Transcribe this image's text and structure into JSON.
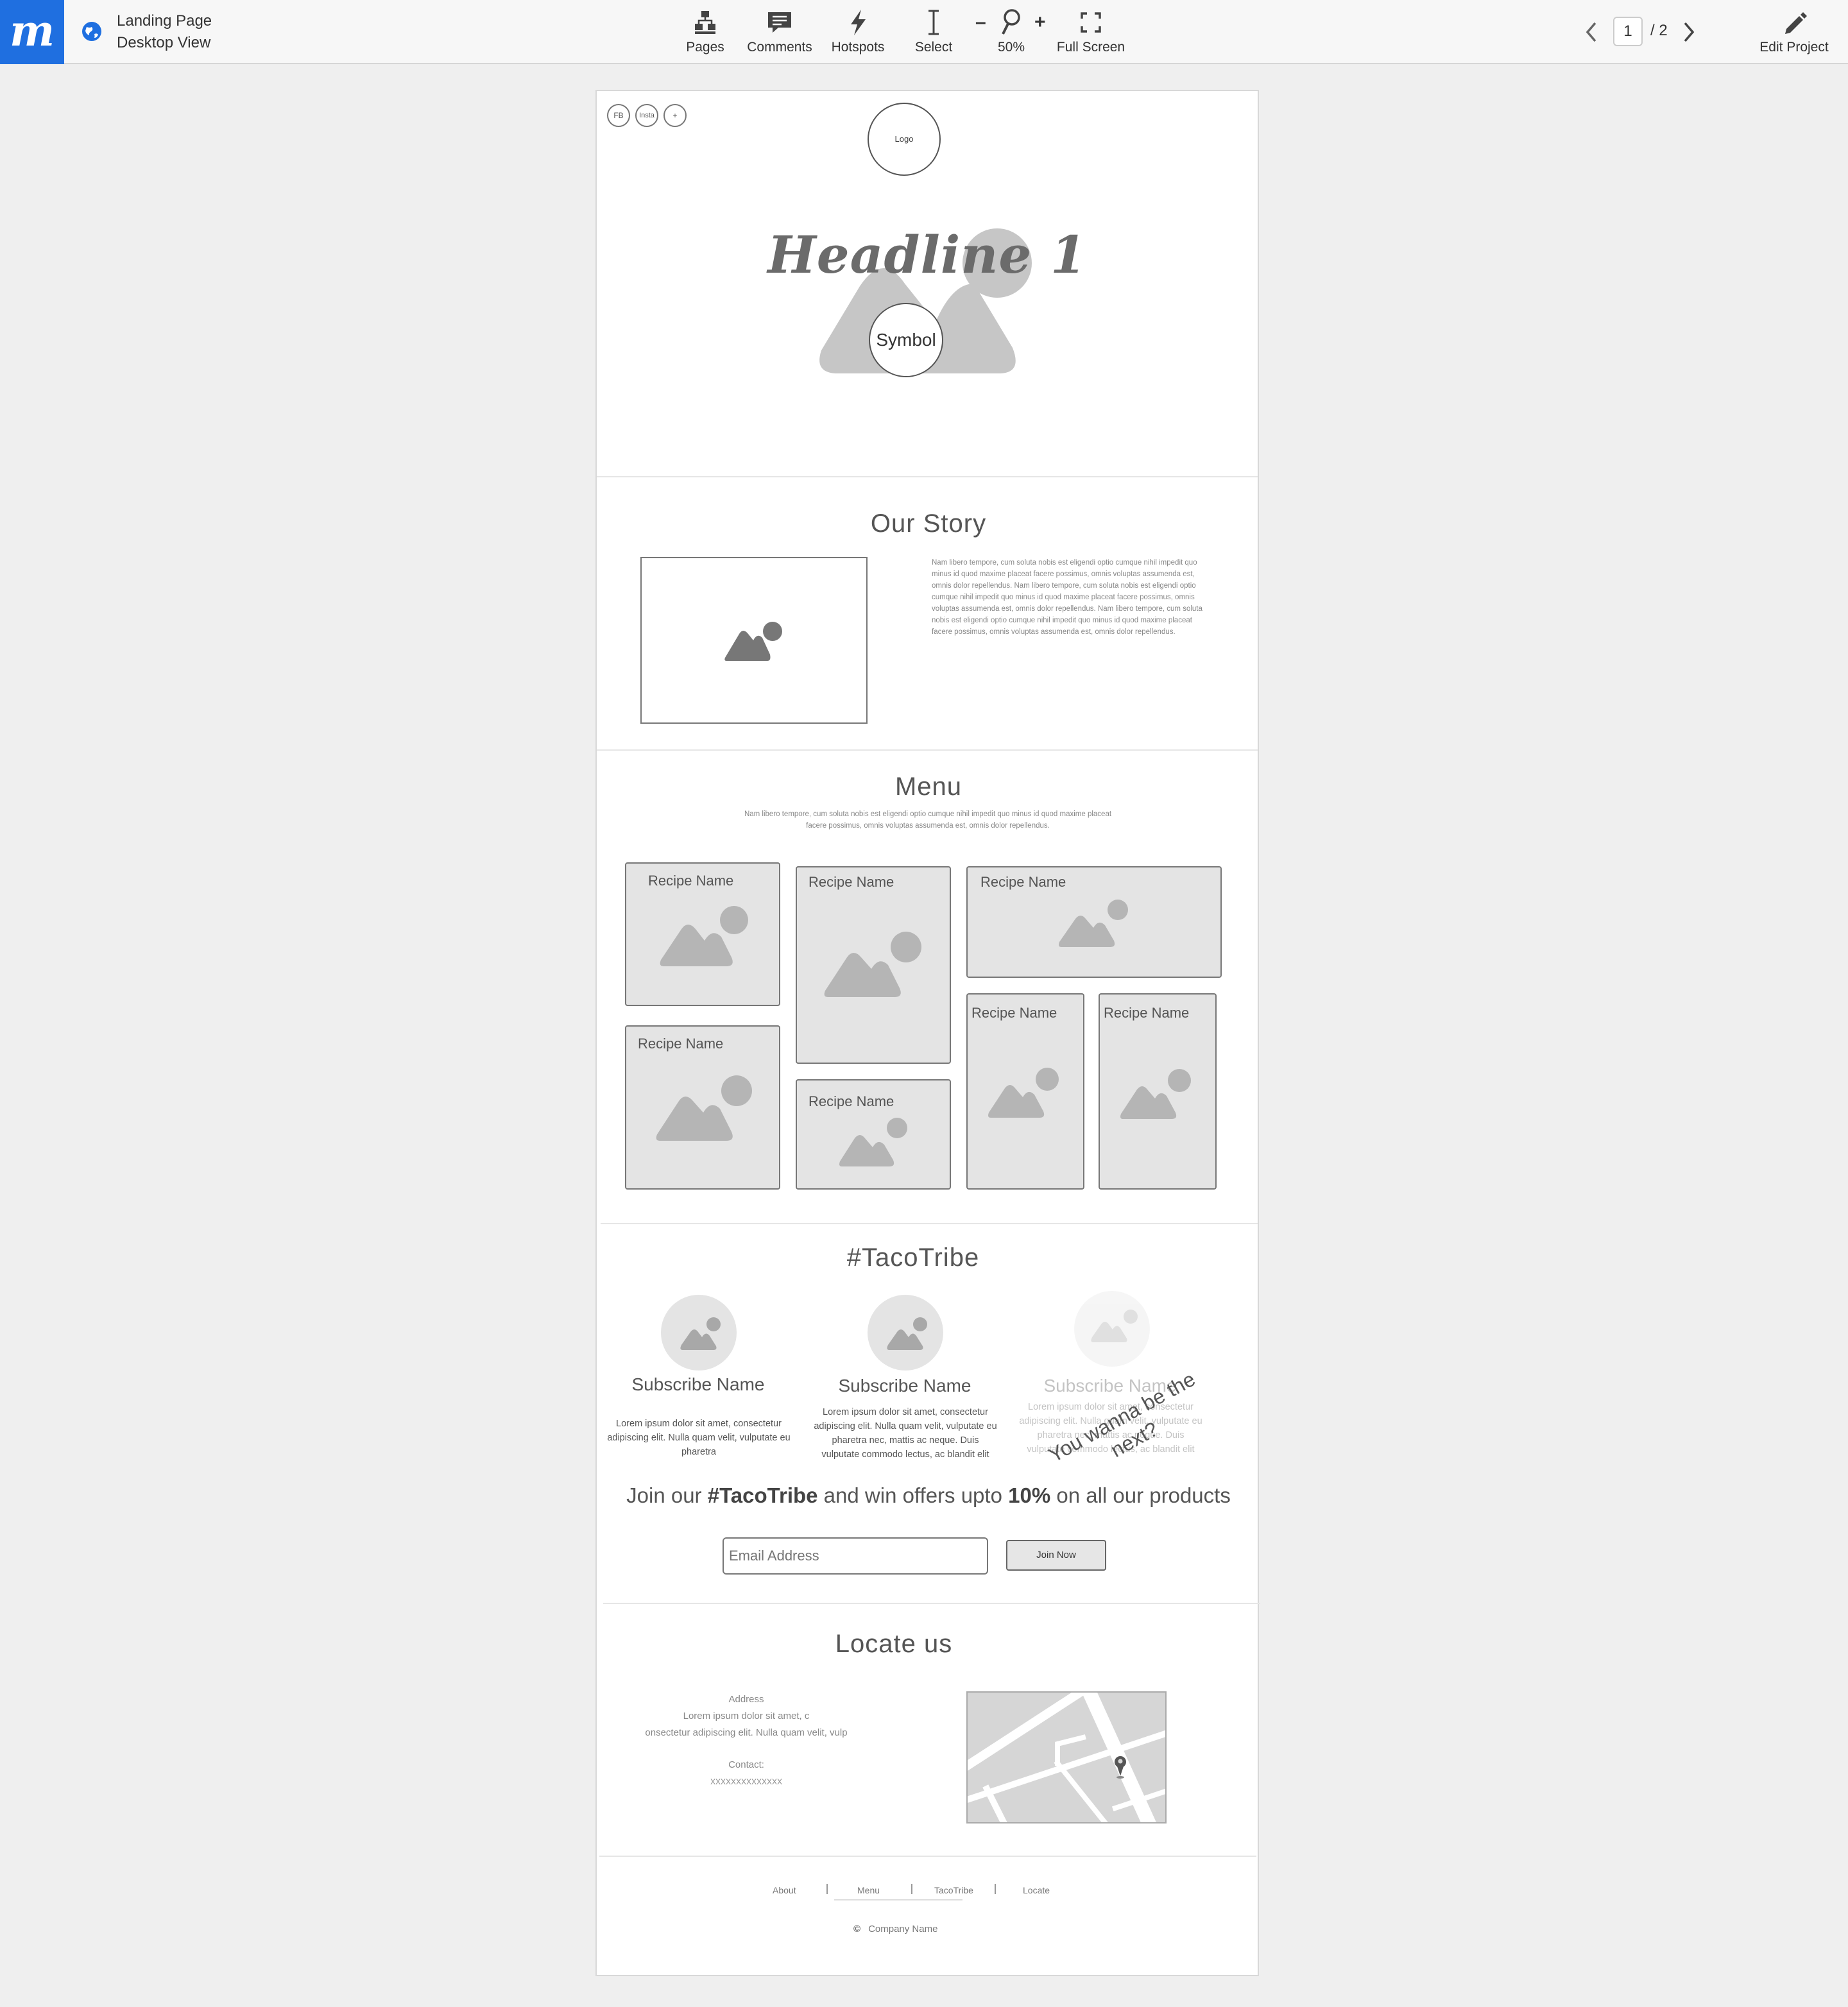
{
  "app": {
    "brand_letter": "m",
    "project_title": "Landing Page",
    "view_name": "Desktop View"
  },
  "toolbar": {
    "pages": "Pages",
    "comments": "Comments",
    "hotspots": "Hotspots",
    "select": "Select",
    "zoom_minus": "–",
    "zoom_plus": "+",
    "zoom_level": "50%",
    "full_screen": "Full Screen",
    "current_page": "1",
    "page_total": "/ 2",
    "edit_project": "Edit Project"
  },
  "hero": {
    "social": [
      "FB",
      "Insta",
      "+"
    ],
    "logo": "Logo",
    "headline": "Headline 1",
    "symbol": "Symbol"
  },
  "story": {
    "title": "Our Story",
    "text": "Nam libero tempore, cum soluta nobis est eligendi optio cumque nihil impedit quo minus id quod maxime placeat facere possimus, omnis voluptas assumenda est, omnis dolor repellendus.  Nam libero tempore, cum soluta nobis est eligendi optio cumque nihil impedit quo minus id quod maxime placeat facere possimus, omnis voluptas assumenda est, omnis dolor repellendus.  Nam libero tempore, cum soluta nobis est eligendi optio cumque nihil impedit quo minus id quod maxime placeat facere possimus, omnis voluptas assumenda est, omnis dolor repellendus."
  },
  "menu": {
    "title": "Menu",
    "description": "Nam libero tempore, cum soluta nobis est eligendi optio cumque nihil impedit quo minus id quod maxime placeat facere possimus, omnis voluptas assumenda est, omnis dolor repellendus.",
    "recipes": [
      "Recipe Name",
      "Recipe Name",
      "Recipe Name",
      "Recipe Name",
      "Recipe Name",
      "Recipe Name",
      "Recipe Name"
    ]
  },
  "tribe": {
    "title": "#TacoTribe",
    "members": [
      {
        "name": "Subscribe Name",
        "text": "Lorem ipsum dolor sit amet, consectetur adipiscing elit. Nulla quam velit, vulputate eu pharetra"
      },
      {
        "name": "Subscribe Name",
        "text": "Lorem ipsum dolor sit amet, consectetur adipiscing elit. Nulla quam velit, vulputate eu pharetra nec, mattis ac neque. Duis vulputate commodo lectus, ac blandit elit"
      },
      {
        "name": "Subscribe Name",
        "text": "Lorem ipsum dolor sit amet, consectetur adipiscing elit. Nulla quam velit, vulputate eu pharetra nec, mattis ac neque. Duis vulputate commodo lectus, ac blandit elit"
      }
    ],
    "overlay_text": "You wanna be the next?",
    "promo_prefix": "Join our ",
    "promo_tag": "#TacoTribe",
    "promo_middle": " and win offers upto ",
    "promo_pct": "10%",
    "promo_suffix": " on all our products",
    "email_placeholder": "Email Address",
    "join_button": "Join Now"
  },
  "locate": {
    "title": "Locate us",
    "address_label": "Address",
    "address_line1": "Lorem ipsum dolor sit amet, c",
    "address_line2": "onsectetur adipiscing elit. Nulla quam velit, vulp",
    "contact_label": "Contact:",
    "contact_value": "XXXXXXXXXXXXXX"
  },
  "footer": {
    "links": [
      "About",
      "Menu",
      "TacoTribe",
      "Locate"
    ],
    "copyright_symbol": "©",
    "company": "Company Name"
  },
  "colors": {
    "brand_blue": "#1f6fe0",
    "card_fill": "#e4e4e4",
    "placeholder_shape": "#b5b5b5"
  }
}
